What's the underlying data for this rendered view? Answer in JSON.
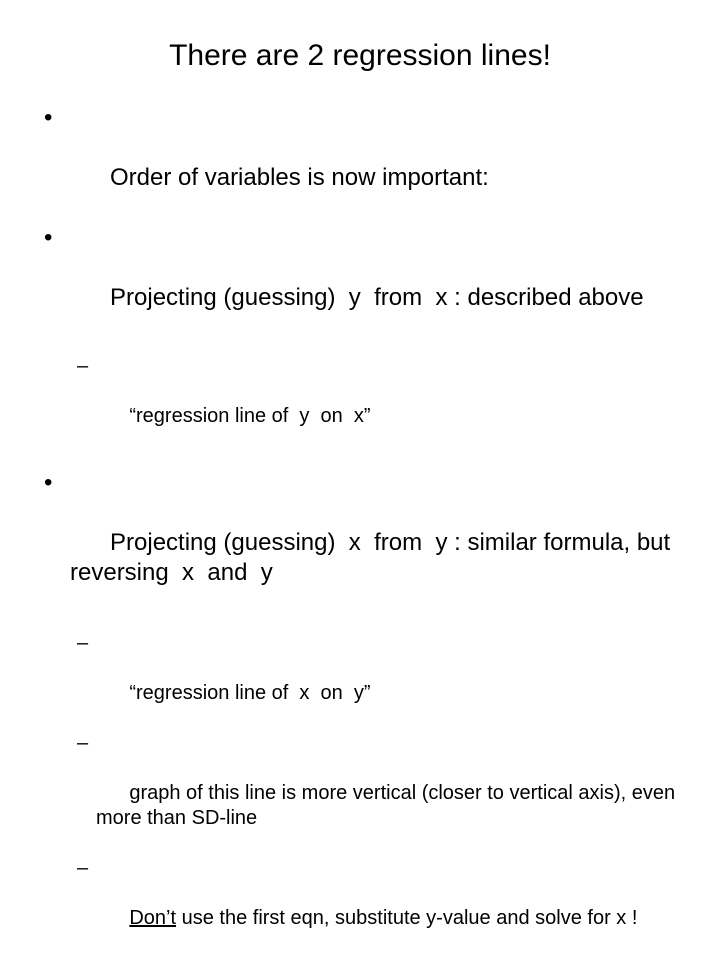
{
  "slide": {
    "title": "There are 2 regression lines!",
    "bullet_marker_level1": "•",
    "bullet_marker_level2": "–",
    "text_color": "#000000",
    "background_color": "#ffffff",
    "bullets": [
      {
        "level": 1,
        "text": "Order of variables is now important:"
      },
      {
        "level": 1,
        "text": "Projecting (guessing)  y  from  x : described above"
      },
      {
        "level": 2,
        "text": "“regression line of  y  on  x”"
      },
      {
        "level": 1,
        "text": "Projecting (guessing)  x  from  y : similar formula, but reversing  x  and  y"
      },
      {
        "level": 2,
        "text": "“regression line of  x  on  y”"
      },
      {
        "level": 2,
        "text": "graph of this line is more vertical (closer to vertical axis), even more than SD-line"
      },
      {
        "level": 2,
        "underlined_prefix": "Don’t",
        "rest": " use the first eqn, substitute y-value and solve for x !"
      }
    ]
  }
}
